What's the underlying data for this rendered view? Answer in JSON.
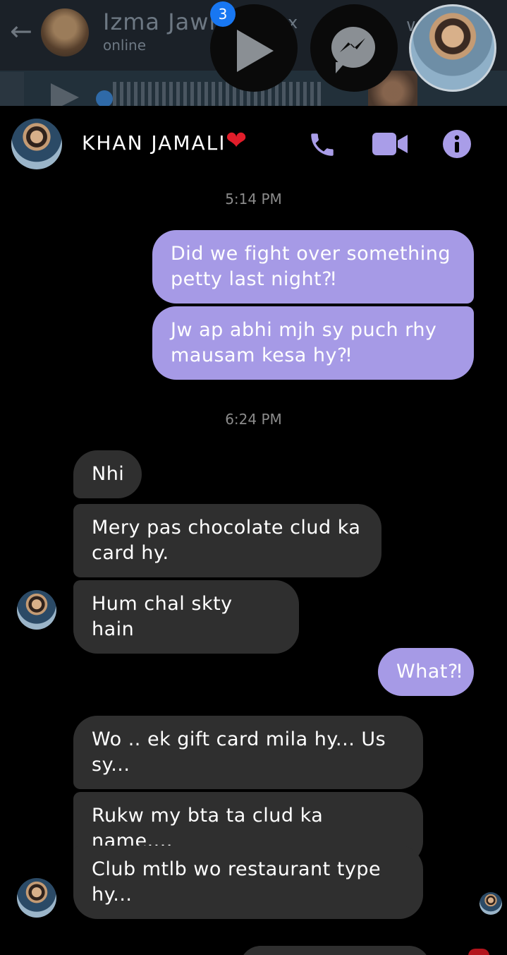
{
  "background": {
    "contact_name": "Izma Jawi",
    "status": "online",
    "close_mark": "x"
  },
  "chat_heads": {
    "badge_count": "3"
  },
  "header": {
    "name": "KHAN JAMALI",
    "heart": "❤"
  },
  "colors": {
    "outgoing_bubble": "#a69ae6",
    "incoming_bubble": "#2f2f2f",
    "accent_icon": "#a99de8",
    "background": "#000000"
  },
  "icons": {
    "call": "phone-icon",
    "video": "video-camera-icon",
    "info": "info-icon"
  },
  "messages": [
    {
      "type": "time",
      "text": "5:14 PM"
    },
    {
      "type": "out",
      "text": "Did we fight over something petty last night⁈"
    },
    {
      "type": "out",
      "text": "Jw ap abhi mjh sy puch rhy mausam kesa hy⁈"
    },
    {
      "type": "time",
      "text": "6:24 PM"
    },
    {
      "type": "in",
      "text": "Nhi"
    },
    {
      "type": "in",
      "text": "Mery pas chocolate clud ka card hy."
    },
    {
      "type": "in",
      "text": "Hum chal skty hain"
    },
    {
      "type": "out",
      "text": "What⁈"
    },
    {
      "type": "in",
      "text": "Wo .. ek gift card mila hy... Us sy..."
    },
    {
      "type": "in",
      "text": "Rukw my bta ta clud ka name...."
    },
    {
      "type": "in",
      "text": "Club mtlb wo restaurant type hy..."
    }
  ]
}
